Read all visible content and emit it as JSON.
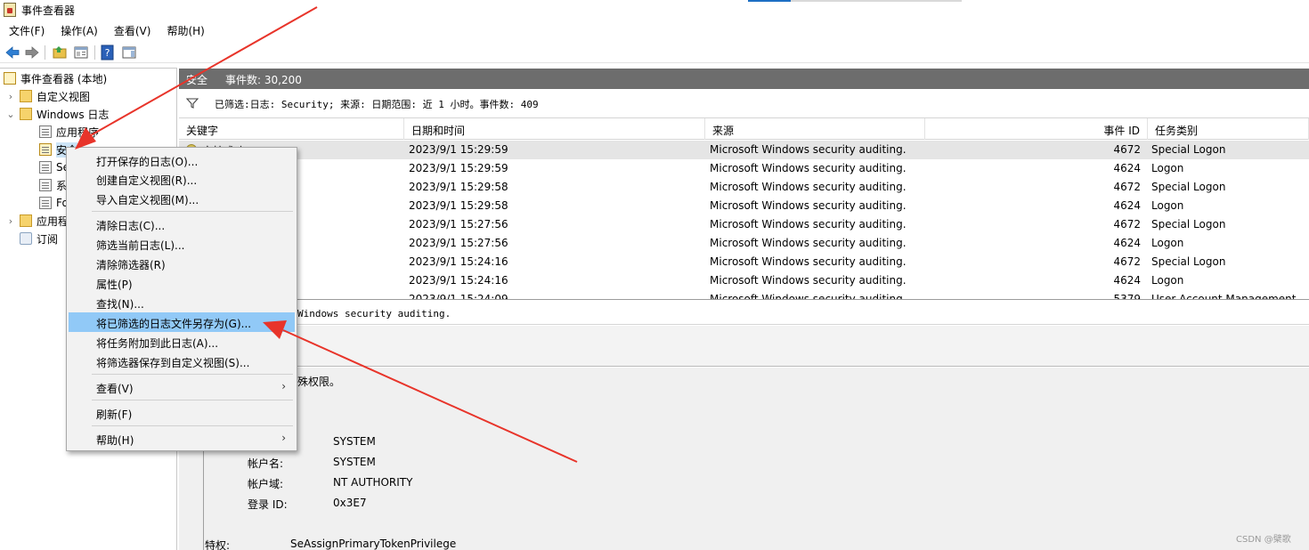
{
  "window": {
    "title": "事件查看器"
  },
  "menubar": [
    "文件(F)",
    "操作(A)",
    "查看(V)",
    "帮助(H)"
  ],
  "toolbar": {
    "icons": [
      "back-arrow-icon",
      "forward-arrow-icon",
      "open-folder-icon",
      "properties-icon",
      "help-icon",
      "console-tree-icon"
    ]
  },
  "tree": {
    "items": [
      {
        "label": "事件查看器 (本地)",
        "chevron": "",
        "icon": "event-viewer-icon"
      },
      {
        "label": "自定义视图",
        "chevron": "›",
        "icon": "folder-icon"
      },
      {
        "label": "Windows 日志",
        "chevron": "⌄",
        "icon": "folder-icon"
      },
      {
        "label": "应用程序",
        "chevron": "",
        "icon": "log-icon"
      },
      {
        "label": "安全",
        "chevron": "",
        "icon": "security-log-icon"
      },
      {
        "label": "Se",
        "chevron": "",
        "icon": "log-icon"
      },
      {
        "label": "系",
        "chevron": "",
        "icon": "log-icon"
      },
      {
        "label": "Fo",
        "chevron": "",
        "icon": "log-icon"
      },
      {
        "label": "应用程",
        "chevron": "›",
        "icon": "folder-icon"
      },
      {
        "label": "订阅",
        "chevron": "",
        "icon": "subscriptions-icon"
      }
    ]
  },
  "header": {
    "log_name": "安全",
    "event_count": "事件数: 30,200"
  },
  "filter": {
    "text": "已筛选:日志: Security; 来源: 日期范围: 近 1 小时。事件数: 409"
  },
  "grid": {
    "columns": [
      "关键字",
      "日期和时间",
      "来源",
      "事件 ID",
      "任务类别"
    ],
    "rows": [
      {
        "keyword": "审核成功",
        "datetime": "2023/9/1 15:29:59",
        "source": "Microsoft Windows security auditing.",
        "event_id": "4672",
        "category": "Special Logon"
      },
      {
        "keyword": "",
        "datetime": "2023/9/1 15:29:59",
        "source": "Microsoft Windows security auditing.",
        "event_id": "4624",
        "category": "Logon"
      },
      {
        "keyword": "",
        "datetime": "2023/9/1 15:29:58",
        "source": "Microsoft Windows security auditing.",
        "event_id": "4672",
        "category": "Special Logon"
      },
      {
        "keyword": "",
        "datetime": "2023/9/1 15:29:58",
        "source": "Microsoft Windows security auditing.",
        "event_id": "4624",
        "category": "Logon"
      },
      {
        "keyword": "",
        "datetime": "2023/9/1 15:27:56",
        "source": "Microsoft Windows security auditing.",
        "event_id": "4672",
        "category": "Special Logon"
      },
      {
        "keyword": "",
        "datetime": "2023/9/1 15:27:56",
        "source": "Microsoft Windows security auditing.",
        "event_id": "4624",
        "category": "Logon"
      },
      {
        "keyword": "",
        "datetime": "2023/9/1 15:24:16",
        "source": "Microsoft Windows security auditing.",
        "event_id": "4672",
        "category": "Special Logon"
      },
      {
        "keyword": "",
        "datetime": "2023/9/1 15:24:16",
        "source": "Microsoft Windows security auditing.",
        "event_id": "4624",
        "category": "Logon"
      },
      {
        "keyword": "",
        "datetime": "2023/9/1 15:24:09",
        "source": "Microsoft Windows security auditing.",
        "event_id": "5379",
        "category": "User Account Management"
      }
    ]
  },
  "detail": {
    "source_line": "Windows security auditing.",
    "privileges_heading": "殊权限。",
    "fields": [
      {
        "label": "",
        "value": "SYSTEM"
      },
      {
        "label": "帐户名:",
        "value": "SYSTEM"
      },
      {
        "label": "帐户域:",
        "value": "NT AUTHORITY"
      },
      {
        "label": "登录 ID:",
        "value": "0x3E7"
      }
    ],
    "privilege_label": "特权:",
    "privilege_value": "SeAssignPrimaryTokenPrivilege"
  },
  "context_menu": {
    "items": [
      {
        "label": "打开保存的日志(O)...",
        "submenu": ""
      },
      {
        "label": "创建自定义视图(R)...",
        "submenu": ""
      },
      {
        "label": "导入自定义视图(M)...",
        "submenu": ""
      },
      {
        "label": "清除日志(C)...",
        "submenu": ""
      },
      {
        "label": "筛选当前日志(L)...",
        "submenu": ""
      },
      {
        "label": "清除筛选器(R)",
        "submenu": ""
      },
      {
        "label": "属性(P)",
        "submenu": ""
      },
      {
        "label": "查找(N)...",
        "submenu": ""
      },
      {
        "label": "将已筛选的日志文件另存为(G)...",
        "submenu": ""
      },
      {
        "label": "将任务附加到此日志(A)...",
        "submenu": ""
      },
      {
        "label": "将筛选器保存到自定义视图(S)...",
        "submenu": ""
      },
      {
        "label": "查看(V)",
        "submenu": "›"
      },
      {
        "label": "刷新(F)",
        "submenu": ""
      },
      {
        "label": "帮助(H)",
        "submenu": "›"
      }
    ],
    "highlighted_index": 8
  },
  "annotation": {
    "arrow_color": "#e8342a"
  },
  "watermark": "CSDN @檗歌"
}
